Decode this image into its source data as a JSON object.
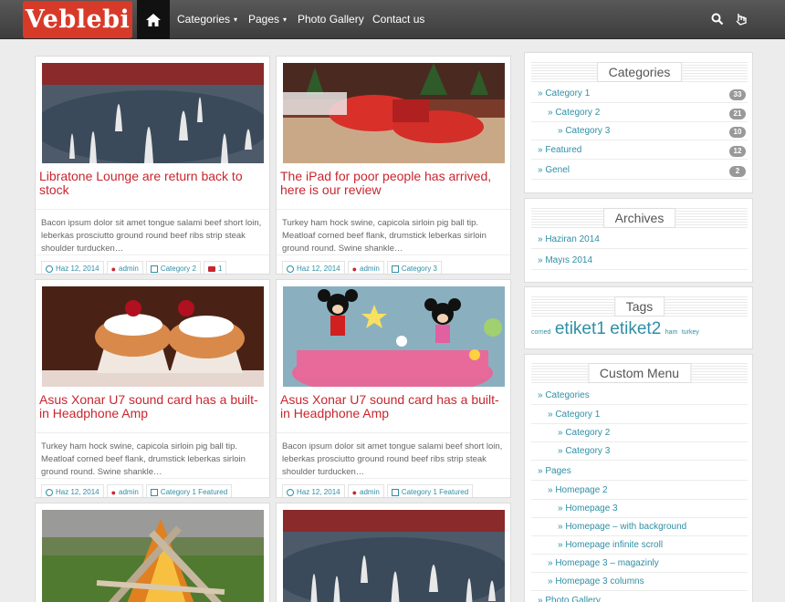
{
  "header": {
    "logo": "Veblebi",
    "nav": [
      {
        "label": "Categories",
        "dropdown": true
      },
      {
        "label": "Pages",
        "dropdown": true
      },
      {
        "label": "Photo Gallery",
        "dropdown": false
      },
      {
        "label": "Contact us",
        "dropdown": false
      }
    ],
    "caret": "▾"
  },
  "posts": [
    {
      "title": "Libratone Lounge are return back to stock",
      "excerpt": "Bacon ipsum dolor sit amet tongue salami beef short loin, leberkas prosciutto ground round beef ribs strip steak shoulder turducken…",
      "date": "Haz 12, 2014",
      "author": "admin",
      "categories": "Category 2",
      "comments": "1"
    },
    {
      "title": "The iPad for poor people has arrived, here is our review",
      "excerpt": "Turkey ham hock swine, capicola sirloin pig ball tip. Meatloaf corned beef flank, drumstick leberkas sirloin ground round. Swine shankle…",
      "date": "Haz 12, 2014",
      "author": "admin",
      "categories": "Category 3"
    },
    {
      "title": "Asus Xonar U7 sound card has a built-in Headphone Amp",
      "excerpt": "Turkey ham hock swine, capicola sirloin pig ball tip. Meatloaf corned beef flank, drumstick leberkas sirloin ground round. Swine shankle…",
      "date": "Haz 12, 2014",
      "author": "admin",
      "categories": "Category 1 Featured"
    },
    {
      "title": "Asus Xonar U7 sound card has a built-in Headphone Amp",
      "excerpt": "Bacon ipsum dolor sit amet tongue salami beef short loin, leberkas prosciutto ground round beef ribs strip steak shoulder turducken…",
      "date": "Haz 12, 2014",
      "author": "admin",
      "categories": "Category 1 Featured"
    }
  ],
  "sidebar": {
    "categories": {
      "title": "Categories",
      "items": [
        {
          "label": "» Category 1",
          "count": "33"
        },
        {
          "label": "» Category 2",
          "count": "21"
        },
        {
          "label": "» Category 3",
          "count": "10"
        },
        {
          "label": "» Featured",
          "count": "12"
        },
        {
          "label": "» Genel",
          "count": "2"
        }
      ]
    },
    "archives": {
      "title": "Archives",
      "items": [
        "» Haziran 2014",
        "» Mayıs 2014"
      ]
    },
    "tags": {
      "title": "Tags",
      "items": [
        {
          "label": "corned",
          "size": 7
        },
        {
          "label": "etiket1",
          "size": 19
        },
        {
          "label": "etiket2",
          "size": 19
        },
        {
          "label": "ham",
          "size": 7
        },
        {
          "label": "turkey",
          "size": 7
        }
      ]
    },
    "custom_menu": {
      "title": "Custom Menu",
      "items": [
        "» Categories",
        "» Category 1",
        "» Category 2",
        "» Category 3",
        "» Pages",
        "» Homepage 2",
        "» Homepage 3",
        "» Homepage – with background",
        "» Homepage infinite scroll",
        "» Homepage 3 – magazinly",
        "» Homepage 3 columns",
        "» Photo Gallery"
      ]
    }
  },
  "colors": {
    "accent": "#c8262e",
    "link": "#2f8fa6",
    "logo_bg": "#d83a2a",
    "nav_bg": "#4a4a4a"
  }
}
